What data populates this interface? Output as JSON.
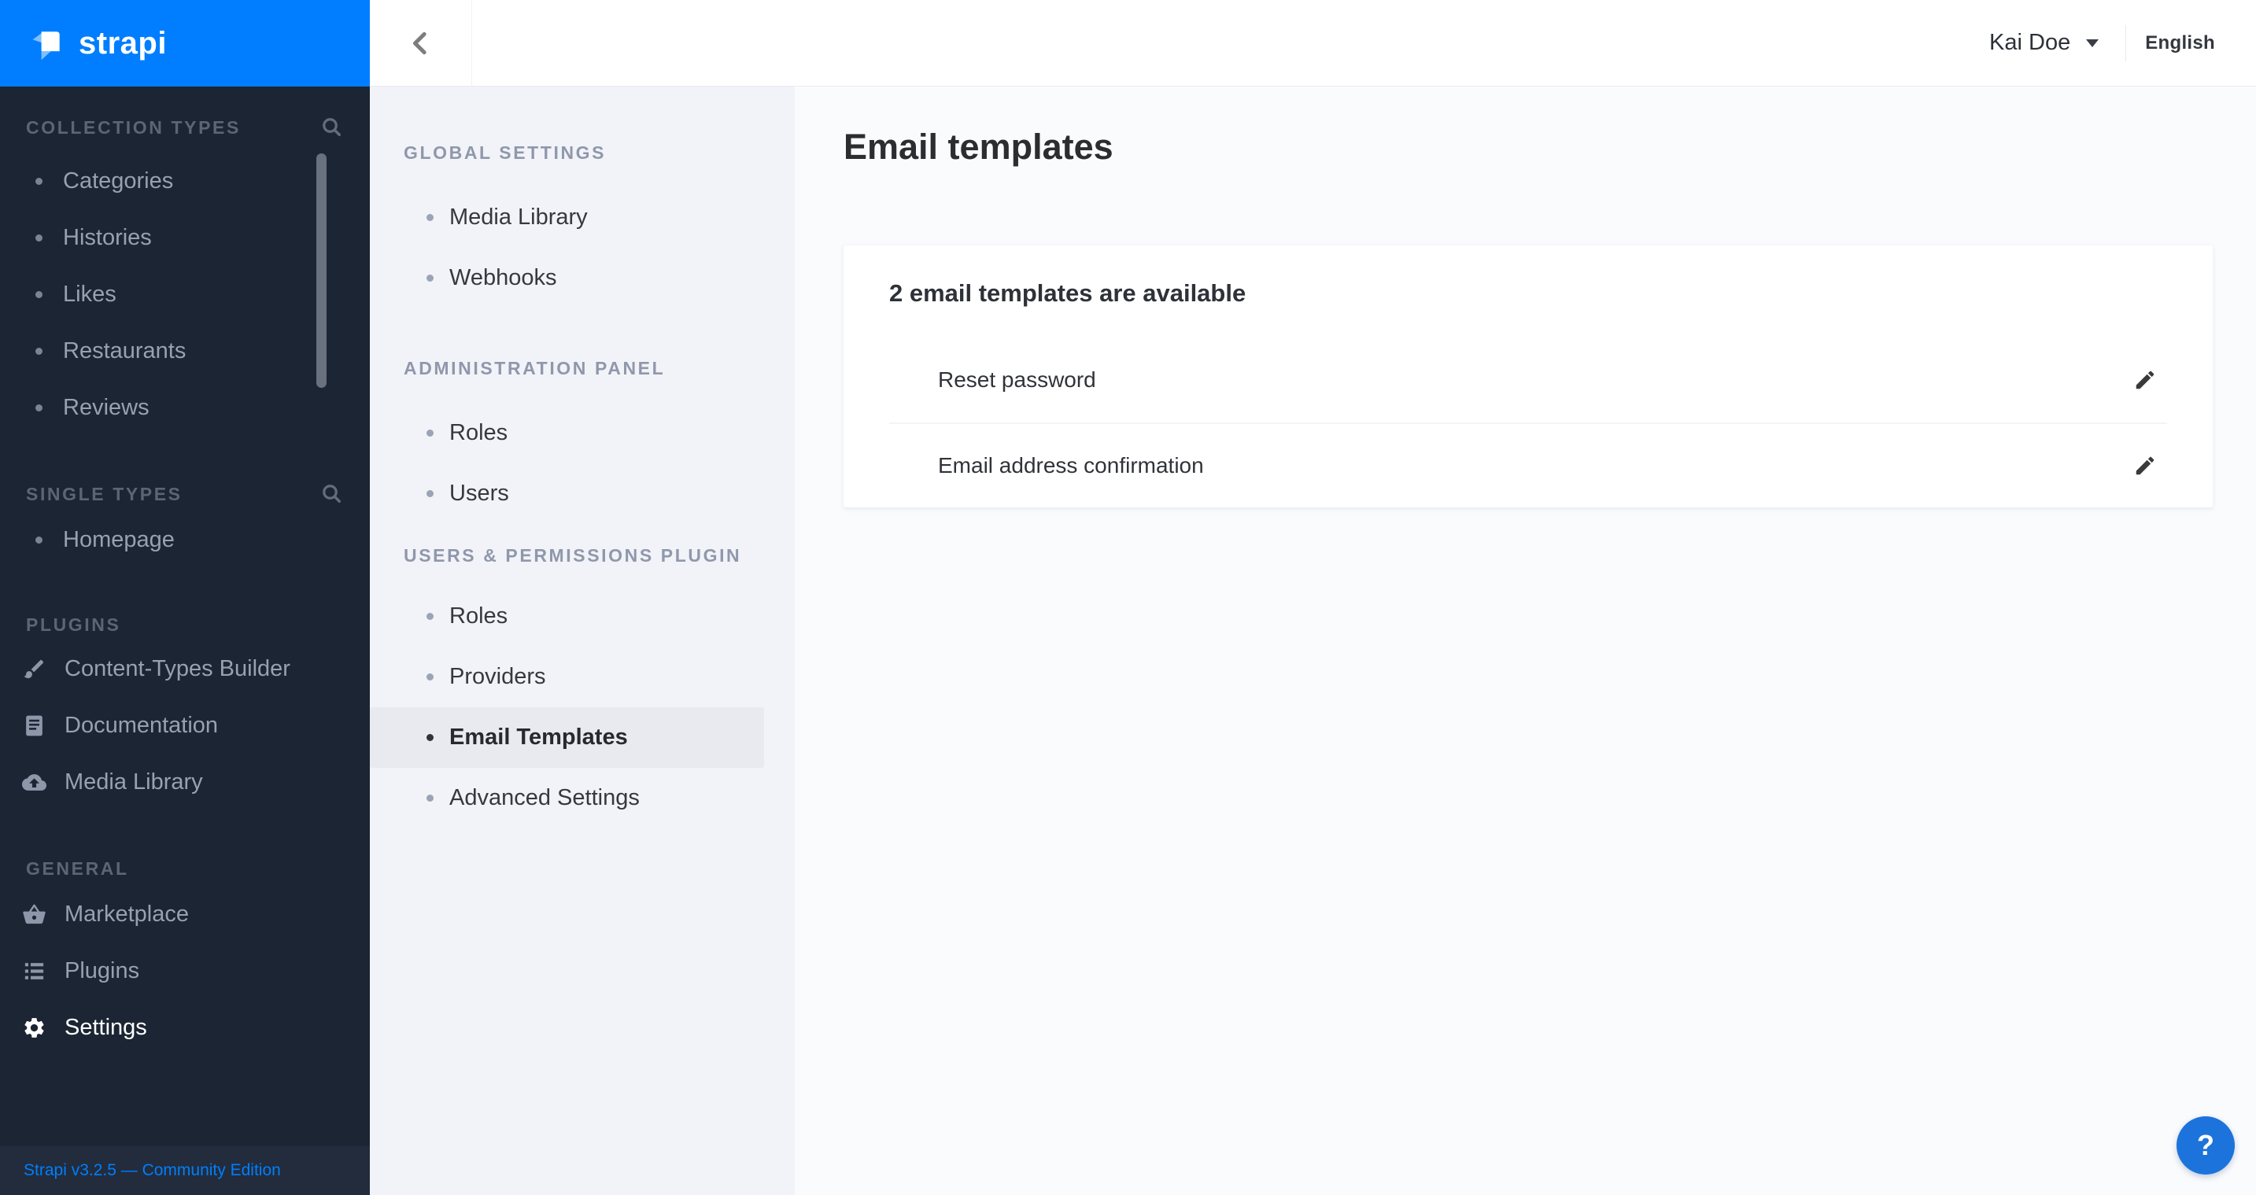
{
  "brand": {
    "name": "strapi",
    "header_bg": "#007eff"
  },
  "topbar": {
    "user": "Kai Doe",
    "language": "English"
  },
  "sidebar": {
    "sections": [
      {
        "label": "COLLECTION TYPES",
        "has_search": true,
        "items": [
          {
            "label": "Categories"
          },
          {
            "label": "Histories"
          },
          {
            "label": "Likes"
          },
          {
            "label": "Restaurants"
          },
          {
            "label": "Reviews"
          }
        ]
      },
      {
        "label": "SINGLE TYPES",
        "has_search": true,
        "items": [
          {
            "label": "Homepage"
          }
        ]
      },
      {
        "label": "PLUGINS",
        "items": [
          {
            "label": "Content-Types Builder",
            "icon": "paintbrush-icon"
          },
          {
            "label": "Documentation",
            "icon": "book-icon"
          },
          {
            "label": "Media Library",
            "icon": "cloud-upload-icon"
          }
        ]
      },
      {
        "label": "GENERAL",
        "items": [
          {
            "label": "Marketplace",
            "icon": "basket-icon"
          },
          {
            "label": "Plugins",
            "icon": "list-icon"
          },
          {
            "label": "Settings",
            "icon": "gear-icon",
            "active": true
          }
        ]
      }
    ],
    "footer": "Strapi v3.2.5 — Community Edition"
  },
  "settings_nav": {
    "sections": [
      {
        "label": "GLOBAL SETTINGS",
        "items": [
          {
            "label": "Media Library"
          },
          {
            "label": "Webhooks"
          }
        ]
      },
      {
        "label": "ADMINISTRATION PANEL",
        "items": [
          {
            "label": "Roles"
          },
          {
            "label": "Users"
          }
        ]
      },
      {
        "label": "USERS & PERMISSIONS PLUGIN",
        "items": [
          {
            "label": "Roles"
          },
          {
            "label": "Providers"
          },
          {
            "label": "Email Templates",
            "selected": true
          },
          {
            "label": "Advanced Settings"
          }
        ]
      }
    ]
  },
  "main": {
    "title": "Email templates",
    "card": {
      "header": "2 email templates are available",
      "rows": [
        {
          "label": "Reset password"
        },
        {
          "label": "Email address confirmation"
        }
      ]
    }
  },
  "help": {
    "label": "?"
  },
  "colors": {
    "brand_blue": "#007eff",
    "help_blue": "#1c73db",
    "sidebar_dark": "#1c2533"
  }
}
